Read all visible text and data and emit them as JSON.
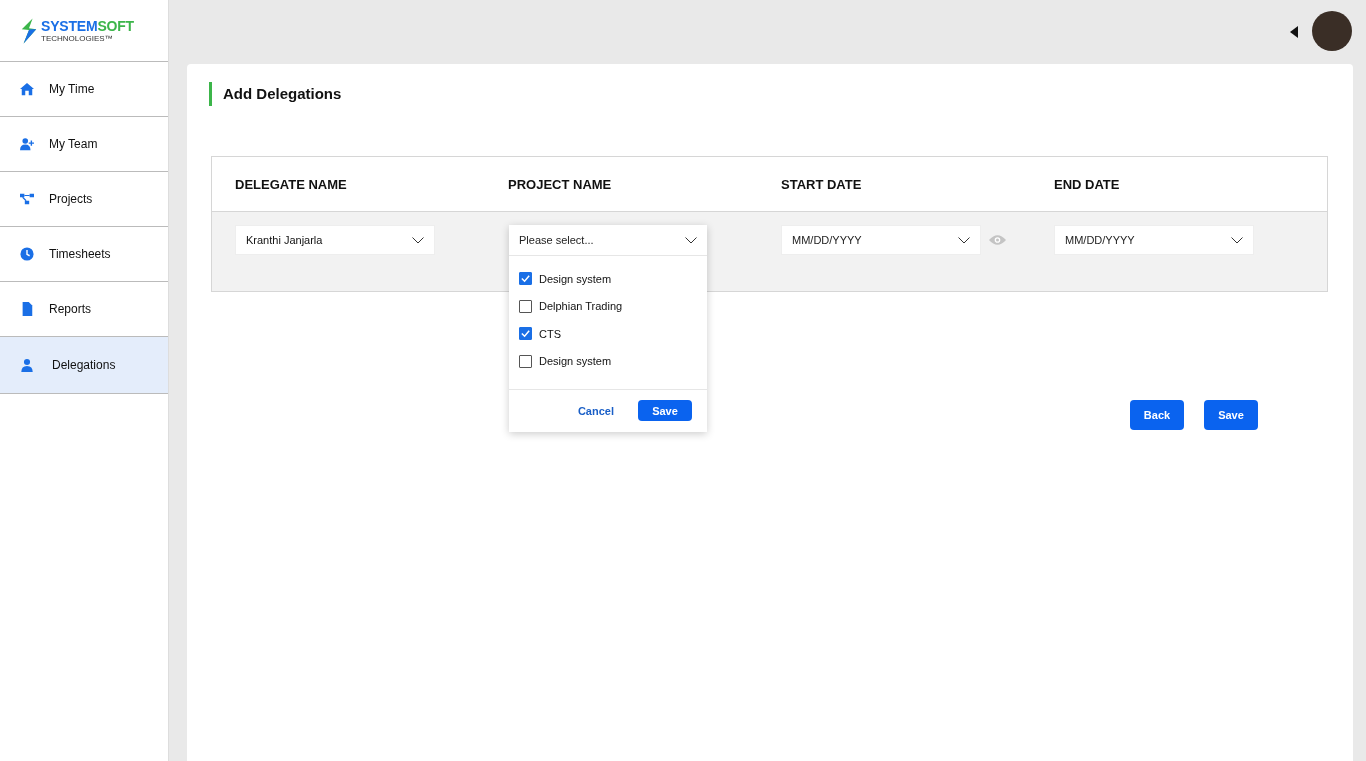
{
  "brand": {
    "word_primary": "SYSTEM",
    "word_secondary": "SOFT",
    "tagline": "TECHNOLOGIES™"
  },
  "sidebar": {
    "items": [
      {
        "label": "My Time",
        "kind": "home",
        "selected": false
      },
      {
        "label": "My Team",
        "kind": "team",
        "selected": false
      },
      {
        "label": "Projects",
        "kind": "projects",
        "selected": false
      },
      {
        "label": "Timesheets",
        "kind": "clock",
        "selected": false
      },
      {
        "label": "Reports",
        "kind": "file",
        "selected": false
      },
      {
        "label": "Delegations",
        "kind": "person",
        "selected": true
      }
    ]
  },
  "page": {
    "title": "Add Delegations"
  },
  "table": {
    "columns": [
      "DELEGATE NAME",
      "PROJECT NAME",
      "START DATE",
      "END DATE"
    ],
    "row": {
      "delegate": {
        "value": "Kranthi Janjarla"
      },
      "project": {
        "placeholder": "Please select..."
      },
      "start_date": {
        "placeholder": "MM/DD/YYYY"
      },
      "end_date": {
        "placeholder": "MM/DD/YYYY"
      }
    }
  },
  "project_dropdown": {
    "options": [
      {
        "label": "Design system",
        "checked": true
      },
      {
        "label": "Delphian Trading",
        "checked": false
      },
      {
        "label": "CTS",
        "checked": true
      },
      {
        "label": "Design system",
        "checked": false
      }
    ],
    "cancel": "Cancel",
    "save": "Save"
  },
  "actions": {
    "back": "Back",
    "save": "Save"
  }
}
